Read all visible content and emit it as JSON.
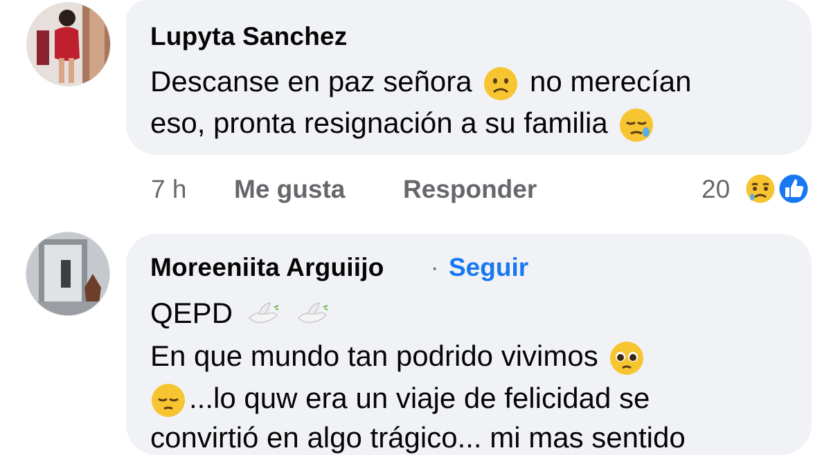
{
  "comments": [
    {
      "author": "Lupyta Sanchez",
      "line1a": "Descanse en paz señora",
      "line1b": "no merecían",
      "line2": "eso, pronta resignación a su familia",
      "time": "7 h",
      "like_label": "Me gusta",
      "reply_label": "Responder",
      "reaction_count": "20",
      "reactions": [
        "sad-icon",
        "like-icon"
      ]
    },
    {
      "author": "Moreeniita Arguiijo",
      "follow_separator": "·",
      "follow_label": "Seguir",
      "line1": "QEPD",
      "line2": "En que mundo tan podrido vivimos",
      "line3": "...lo quw era un viaje de felicidad se",
      "line4": "convirtió en algo trágico... mi mas sentido"
    }
  ],
  "colors": {
    "bubble": "#f0f2f5",
    "link": "#1877f2",
    "meta": "#65676b"
  }
}
